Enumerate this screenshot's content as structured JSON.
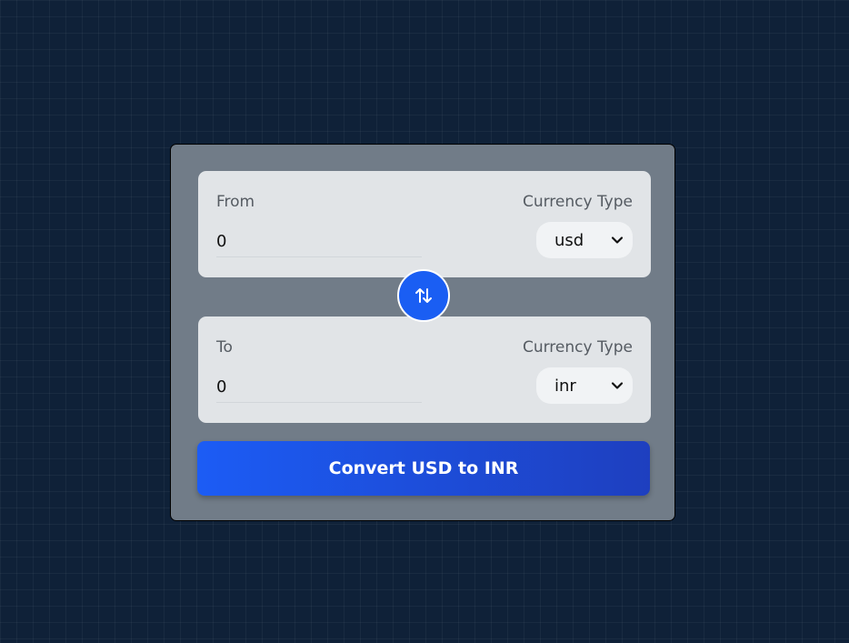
{
  "from": {
    "label": "From",
    "currency_label": "Currency Type",
    "amount": "0",
    "currency": "usd"
  },
  "to": {
    "label": "To",
    "currency_label": "Currency Type",
    "amount": "0",
    "currency": "inr"
  },
  "swap": {
    "icon": "swap-arrows-icon"
  },
  "convert_button": {
    "label": "Convert USD to INR"
  },
  "colors": {
    "page_background": "#0f2138",
    "card": "#717c88",
    "panel": "#e1e4e7",
    "accent": "#1a5ef3"
  }
}
